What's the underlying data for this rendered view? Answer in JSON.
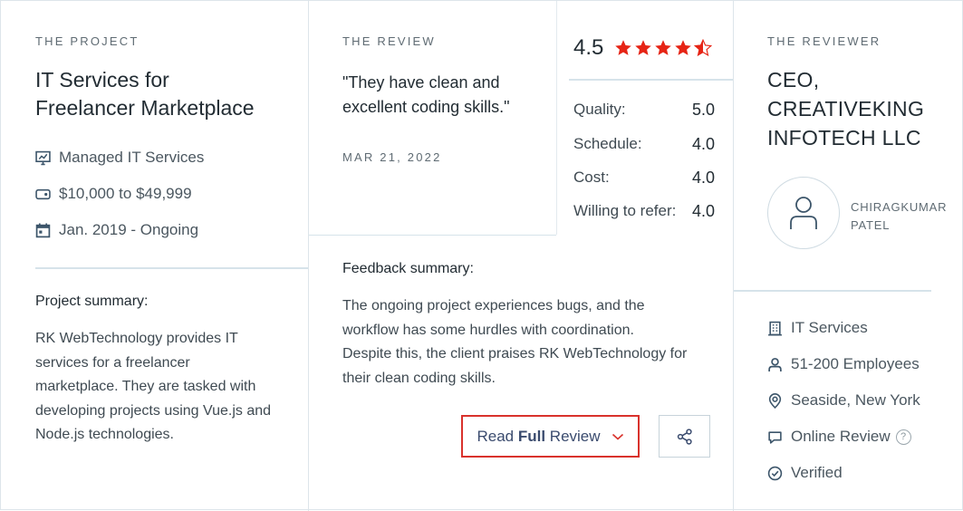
{
  "project": {
    "eyebrow": "THE PROJECT",
    "title_line1": "IT Services for",
    "title_line2": "Freelancer Marketplace",
    "service": "Managed IT Services",
    "budget": "$10,000 to $49,999",
    "timeline": "Jan. 2019 - Ongoing",
    "summary_label": "Project summary:",
    "summary_lines": [
      "RK WebTechnology provides IT",
      "services for a freelancer",
      "marketplace. They are tasked with",
      "developing projects using Vue.js and",
      "Node.js technologies."
    ]
  },
  "review": {
    "eyebrow": "THE REVIEW",
    "quote_line1": "\"They have clean and",
    "quote_line2": "excellent coding skills.\"",
    "date": "MAR 21, 2022",
    "overall": "4.5",
    "overall_stars": 4.5,
    "scores": [
      {
        "label": "Quality:",
        "value": "5.0"
      },
      {
        "label": "Schedule:",
        "value": "4.0"
      },
      {
        "label": "Cost:",
        "value": "4.0"
      },
      {
        "label": "Willing to refer:",
        "value": "4.0"
      }
    ],
    "feedback_label": "Feedback summary:",
    "feedback_lines": [
      "The ongoing project experiences bugs, and the",
      "workflow has some hurdles with coordination.",
      "Despite this, the client praises RK WebTechnology for",
      "their clean coding skills."
    ],
    "read_full_prefix": "Read ",
    "read_full_bold": "Full",
    "read_full_suffix": " Review"
  },
  "reviewer": {
    "eyebrow": "THE REVIEWER",
    "title_lines": [
      "CEO,",
      "CREATIVEKING",
      "INFOTECH LLC"
    ],
    "name_line1": "CHIRAGKUMAR",
    "name_line2": "PATEL",
    "industry": "IT Services",
    "size": "51-200 Employees",
    "location": "Seaside, New York",
    "review_type": "Online Review",
    "help_glyph": "?",
    "verification": "Verified"
  },
  "colors": {
    "accent_red": "#d9322c",
    "star": "#e62415",
    "button_text": "#3a4b6e",
    "divider": "#d6e3ea"
  },
  "icons": {
    "service": "monitor-chart-icon",
    "budget": "price-tag-icon",
    "timeline": "calendar-icon",
    "industry": "building-icon",
    "size": "person-icon",
    "location": "location-pin-icon",
    "review_type": "chat-bubble-icon",
    "verified": "check-circle-icon",
    "share": "share-icon",
    "avatar": "user-avatar-icon"
  }
}
